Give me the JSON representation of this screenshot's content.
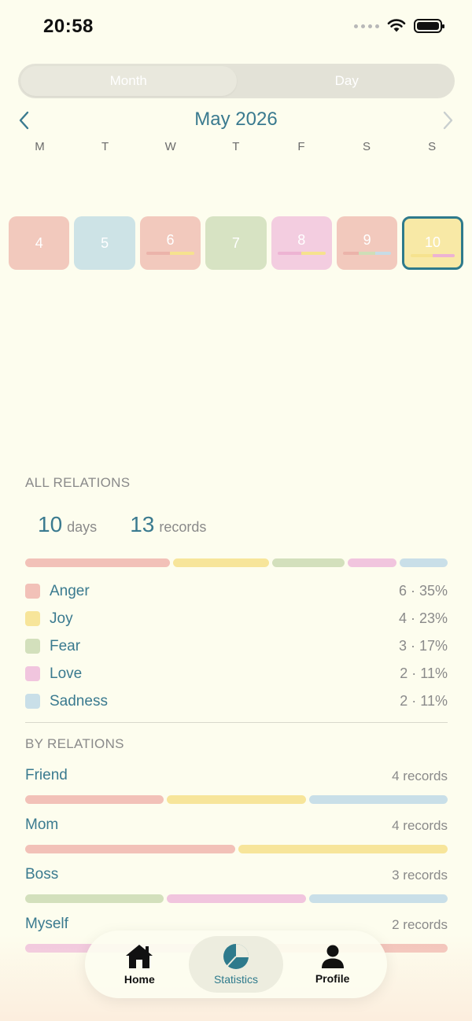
{
  "status": {
    "time": "20:58"
  },
  "segment": {
    "options": [
      "Month",
      "Day"
    ],
    "selected": "Month"
  },
  "calendar": {
    "title": "May 2026",
    "weekdays": [
      "M",
      "T",
      "W",
      "T",
      "F",
      "S",
      "S"
    ],
    "days": [
      {
        "num": "4",
        "color": "#F2C9BD",
        "bar": []
      },
      {
        "num": "5",
        "color": "#CDE3E6",
        "bar": []
      },
      {
        "num": "6",
        "color": "#F2C9BD",
        "bar": [
          "#EBB3AA",
          "#F6E28E"
        ]
      },
      {
        "num": "7",
        "color": "#D7E3C3",
        "bar": []
      },
      {
        "num": "8",
        "color": "#F3CDE0",
        "bar": [
          "#EDB3D3",
          "#F6E28E"
        ]
      },
      {
        "num": "9",
        "color": "#F2C9BD",
        "bar": [
          "#EBB3AA",
          "#CFDEB7",
          "#C7DCE6"
        ]
      },
      {
        "num": "10",
        "color": "#F8E9A6",
        "bar": [
          "#F6E28E",
          "#EDB3D3"
        ],
        "selected": true
      }
    ]
  },
  "all_relations": {
    "label": "ALL RELATIONS",
    "days_num": "10",
    "days_unit": "days",
    "records_num": "13",
    "records_unit": "records",
    "emotions": [
      {
        "name": "Anger",
        "value": "6 · 35%",
        "count": 6,
        "color": "#F2C1B8"
      },
      {
        "name": "Joy",
        "value": "4 · 23%",
        "count": 4,
        "color": "#F7E59A"
      },
      {
        "name": "Fear",
        "value": "3 · 17%",
        "count": 3,
        "color": "#D3E0BC"
      },
      {
        "name": "Love",
        "value": "2 · 11%",
        "count": 2,
        "color": "#F1C5DE"
      },
      {
        "name": "Sadness",
        "value": "2 · 11%",
        "count": 2,
        "color": "#C9DFE8"
      }
    ]
  },
  "by_relations": {
    "label": "BY RELATIONS",
    "items": [
      {
        "name": "Friend",
        "count": "4 records",
        "bar": [
          "#F2C1B8",
          "#F7E59A",
          "#C9DFE8"
        ]
      },
      {
        "name": "Mom",
        "count": "4 records",
        "bar": [
          "#F2C1B8",
          "#F7E59A"
        ]
      },
      {
        "name": "Boss",
        "count": "3 records",
        "bar": [
          "#D3E0BC",
          "#F1C5DE",
          "#C9DFE8"
        ]
      },
      {
        "name": "Myself",
        "count": "2 records",
        "bar": [
          "#F1C5DE",
          "#F2C1B8"
        ]
      }
    ]
  },
  "tabbar": {
    "items": [
      {
        "label": "Home",
        "icon": "home-icon"
      },
      {
        "label": "Statistics",
        "icon": "pie-chart-icon",
        "active": true
      },
      {
        "label": "Profile",
        "icon": "person-icon"
      }
    ]
  }
}
